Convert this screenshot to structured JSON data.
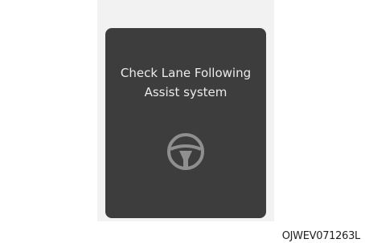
{
  "display": {
    "message_line1": "Check Lane Following",
    "message_line2": "Assist system",
    "icon": "steering-wheel-icon"
  },
  "caption": "OJWEV071263L",
  "colors": {
    "panel": "#3d3d3d",
    "text": "#ebebeb",
    "icon": "#8f8f8f",
    "backdrop": "#f2f2f2"
  }
}
